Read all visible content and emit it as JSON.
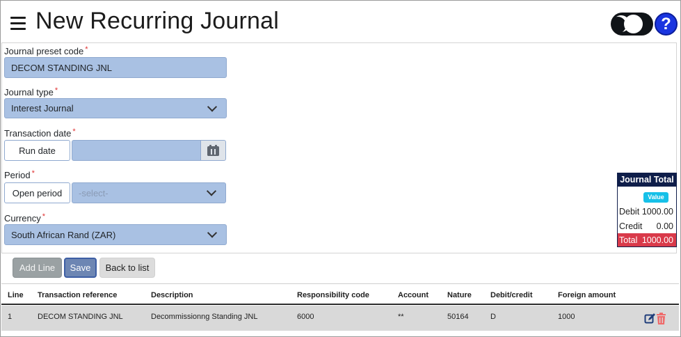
{
  "header": {
    "title": "New Recurring Journal",
    "help_label": "?"
  },
  "form": {
    "preset_code": {
      "label": "Journal preset code",
      "required_mark": "*",
      "value": "DECOM STANDING JNL"
    },
    "journal_type": {
      "label": "Journal type",
      "required_mark": "*",
      "value": "Interest Journal"
    },
    "transaction_date": {
      "label": "Transaction date",
      "required_mark": "*",
      "mode_button": "Run date",
      "value": ""
    },
    "period": {
      "label": "Period",
      "required_mark": "*",
      "mode_button": "Open period",
      "placeholder": "-select-"
    },
    "currency": {
      "label": "Currency",
      "required_mark": "*",
      "value": "South African Rand (ZAR)"
    }
  },
  "journal_total": {
    "title": "Journal Total",
    "badge": "Value",
    "debit_label": "Debit",
    "debit_value": "1000.00",
    "credit_label": "Credit",
    "credit_value": "0.00",
    "total_label": "Total",
    "total_value": "1000.00",
    "colors": {
      "header": "#0f1e4a",
      "badge": "#16c0e8",
      "total": "#d93a4a"
    }
  },
  "actions": {
    "add_line": "Add Line",
    "save": "Save",
    "back": "Back to list"
  },
  "table": {
    "columns": [
      "Line",
      "Transaction reference",
      "Description",
      "Responsibility code",
      "Account",
      "Nature",
      "Debit/credit",
      "Foreign amount"
    ],
    "rows": [
      [
        "1",
        "DECOM STANDING JNL",
        "Decommissionng Standing JNL",
        "6000",
        "**",
        "50164",
        "D",
        "1000"
      ]
    ],
    "row_icons": [
      "edit-icon",
      "delete-icon"
    ]
  },
  "icons": [
    "menu-icon",
    "moon-icon",
    "help-icon",
    "calendar-icon",
    "chevron-down-icon"
  ],
  "colors": {
    "input_bg": "#a9c1e3",
    "save_button": "#6d86b3",
    "help_button": "#1a35e0"
  }
}
